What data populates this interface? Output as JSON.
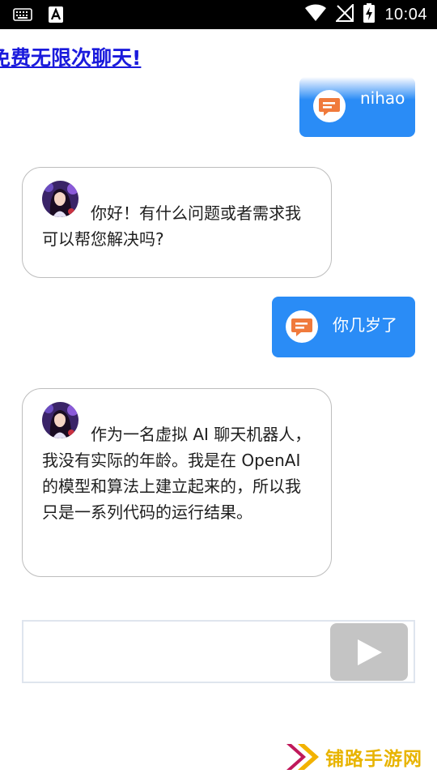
{
  "status_bar": {
    "time": "10:04"
  },
  "header": {
    "marquee_text": "免费无限次聊天!"
  },
  "messages": [
    {
      "role": "user",
      "text": "nihao"
    },
    {
      "role": "bot",
      "text": "你好！有什么问题或者需求我可以帮您解决吗?"
    },
    {
      "role": "user",
      "text": "你几岁了"
    },
    {
      "role": "bot",
      "text": "作为一名虚拟 AI 聊天机器人，我没有实际的年龄。我是在 OpenAI 的模型和算法上建立起来的，所以我只是一系列代码的运行结果。"
    }
  ],
  "input": {
    "value": "",
    "placeholder": ""
  },
  "watermark": {
    "text": "铺路手游网"
  },
  "colors": {
    "user_bubble": "#2a8cf6",
    "send_button": "#c4c4c4",
    "marquee": "#1a1adc",
    "chat_icon": "#f07a3c"
  }
}
